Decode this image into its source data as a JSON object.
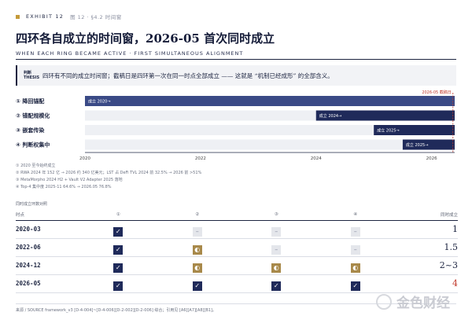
{
  "header": {
    "exhibit": "EXHIBIT 12",
    "meta": "图 12  ·  §4.2 时间窗"
  },
  "title": "四环各自成立的时间窗，2026-05 首次同时成立",
  "subtitle": "WHEN EACH RING BECAME ACTIVE · FIRST SIMULTANEOUS ALIGNMENT",
  "thesis": {
    "label_1": "判断",
    "label_2": "THESIS",
    "text": "四环有不同的成立时间窗；截稿日是四环第一次在同一时点全部成立 —— 这就是 “机制已经成形” 的全部含义。"
  },
  "chart_data": {
    "type": "bar",
    "title": "",
    "xlim": [
      2020.0,
      2026.4
    ],
    "x_ticks": [
      "2020",
      "2022",
      "2024",
      "2026"
    ],
    "marker": {
      "x": 2026.37,
      "label": "2026-05 截稿日"
    },
    "series": [
      {
        "name": "① 降回锚配",
        "start": 2020.0,
        "bar_label": "成立 2020→"
      },
      {
        "name": "② 错配规模化",
        "start": 2024.0,
        "bar_label": "成立 2024→"
      },
      {
        "name": "③ 嵌套传染",
        "start": 2025.0,
        "bar_label": "成立 2025→"
      },
      {
        "name": "④ 判断权集中",
        "start": 2025.5,
        "bar_label": "成立 2025→"
      }
    ]
  },
  "notes": [
    "① 2020 至今始终成立",
    "② RWA 2024 年 152 亿 → 2026 约 340 亿美元；LST 占 DeFi TVL 2024 前 32.5% → 2026 前 >51%",
    "③ MetaMorpho 2024 H2 + Vault V2 Adapter 2025 落地",
    "④ Top-4 集中度 2025-11 64.6% → 2026.05 76.8%"
  ],
  "table": {
    "caption": "同时成立环数对照",
    "headers": [
      "时点",
      "①",
      "②",
      "③",
      "④",
      "同时成立"
    ],
    "rows": [
      {
        "date": "2020-03",
        "cells": [
          "on",
          "off",
          "off",
          "off"
        ],
        "count": "1"
      },
      {
        "date": "2022-06",
        "cells": [
          "on",
          "half",
          "off",
          "off"
        ],
        "count": "1.5"
      },
      {
        "date": "2024-12",
        "cells": [
          "on",
          "half",
          "half",
          "half"
        ],
        "count": "2~3"
      },
      {
        "date": "2026-05",
        "cells": [
          "on",
          "on",
          "on",
          "on"
        ],
        "count": "4"
      }
    ]
  },
  "footer": "来源 / SOURCE  framework_v3 [D-4-004]~[D-4-006][D-2-002][D-2-006] 综合；引用见 [A6][A7][A8][B1]。",
  "watermark": "金色财经",
  "symbols": {
    "on": "✓",
    "half": "◐",
    "off": "–"
  },
  "colors": {
    "navy": "#1f2a5a",
    "gold": "#a8894a",
    "red": "#c0392b"
  }
}
